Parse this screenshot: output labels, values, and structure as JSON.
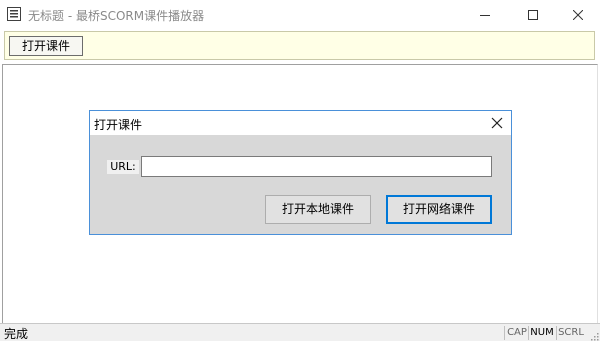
{
  "window": {
    "title": "无标题 - 最桥SCORM课件播放器"
  },
  "toolbar": {
    "open_label": "打开课件"
  },
  "dialog": {
    "title": "打开课件",
    "url_label": "URL:",
    "url_value": "",
    "open_local_label": "打开本地课件",
    "open_network_label": "打开网络课件"
  },
  "statusbar": {
    "text": "完成",
    "cap": "CAP",
    "num": "NUM",
    "scrl": "SCRL"
  },
  "colors": {
    "toolbar_bg": "#ffffe6",
    "dialog_body_bg": "#d8d8d8",
    "dialog_border": "#4a90d9",
    "default_button_border": "#0078d7"
  },
  "icons": {
    "app": "app-icon",
    "minimize": "minimize-icon",
    "maximize": "maximize-icon",
    "close": "close-icon",
    "dialog_close": "close-icon"
  }
}
